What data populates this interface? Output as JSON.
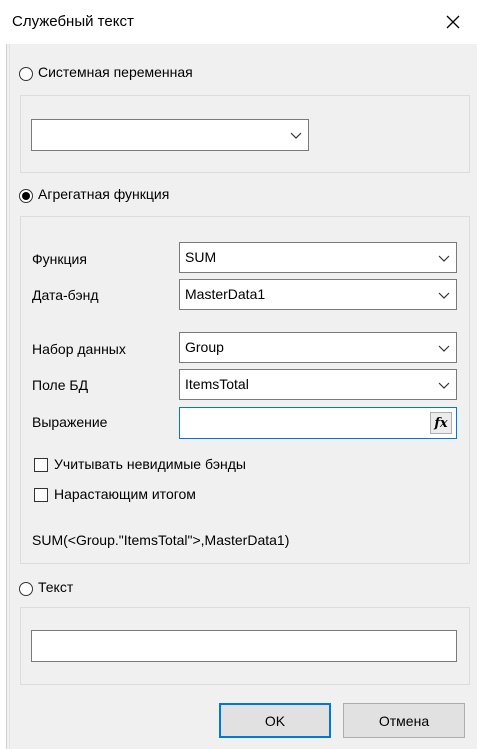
{
  "dialog": {
    "title": "Служебный текст"
  },
  "system_variable": {
    "label": "Системная переменная",
    "selected": false,
    "combo_value": ""
  },
  "aggregate": {
    "label": "Агрегатная функция",
    "selected": true,
    "function": {
      "label": "Функция",
      "value": "SUM"
    },
    "databand": {
      "label": "Дата-бэнд",
      "value": "MasterData1"
    },
    "dataset": {
      "label": "Набор данных",
      "value": "Group"
    },
    "db_field": {
      "label": "Поле БД",
      "value": "ItemsTotal"
    },
    "expression": {
      "label": "Выражение",
      "value": "",
      "fx_label": "fx"
    },
    "count_invisible": {
      "label": "Учитывать невидимые бэнды",
      "checked": false
    },
    "running_total": {
      "label": "Нарастающим итогом",
      "checked": false
    },
    "result_text": "SUM(<Group.\"ItemsTotal\">,MasterData1)"
  },
  "text_option": {
    "label": "Текст",
    "selected": false,
    "value": ""
  },
  "buttons": {
    "ok": "OK",
    "cancel": "Отмена"
  },
  "icons": {
    "close": "close-icon",
    "chevron": "chevron-down-icon",
    "fx": "function-icon"
  },
  "colors": {
    "focus_border": "#0078d7",
    "dialog_bg": "#f0f0f0"
  }
}
